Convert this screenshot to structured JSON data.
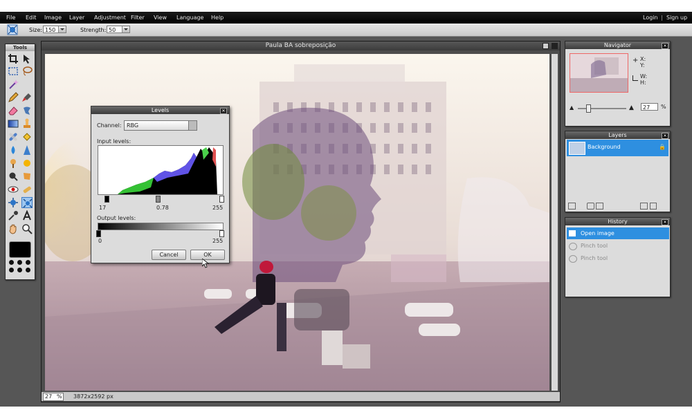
{
  "menubar": {
    "items": [
      "File",
      "Edit",
      "Image",
      "Layer",
      "Adjustment",
      "Filter",
      "View",
      "Language",
      "Help"
    ],
    "login": "Login",
    "separator": "|",
    "signup": "Sign up"
  },
  "toolbar": {
    "size_label": "Size:",
    "size_value": "150",
    "strength_label": "Strength:",
    "strength_value": "50"
  },
  "tools_panel": {
    "title": "Tools"
  },
  "document": {
    "title": "Paula BA sobreposição",
    "zoom": "27",
    "zoom_unit": "%",
    "dimensions": "3872x2592 px"
  },
  "levels_dialog": {
    "title": "Levels",
    "channel_label": "Channel:",
    "channel_value": "RBG",
    "input_label": "Input levels:",
    "input_black": "17",
    "input_gamma": "0.78",
    "input_white": "255",
    "output_label": "Output levels:",
    "output_black": "0",
    "output_white": "255",
    "cancel_label": "Cancel",
    "ok_label": "OK"
  },
  "navigator": {
    "title": "Navigator",
    "x_label": "X:",
    "y_label": "Y:",
    "w_label": "W:",
    "h_label": "H:",
    "zoom_value": "27",
    "zoom_unit": "%"
  },
  "layers": {
    "title": "Layers",
    "items": [
      {
        "name": "Background"
      }
    ]
  },
  "history": {
    "title": "History",
    "items": [
      "Open image",
      "Pinch tool",
      "Pinch tool"
    ]
  },
  "colors": {
    "accent": "#2e8fe0",
    "menubar": "#000000",
    "workspace": "#565656"
  }
}
